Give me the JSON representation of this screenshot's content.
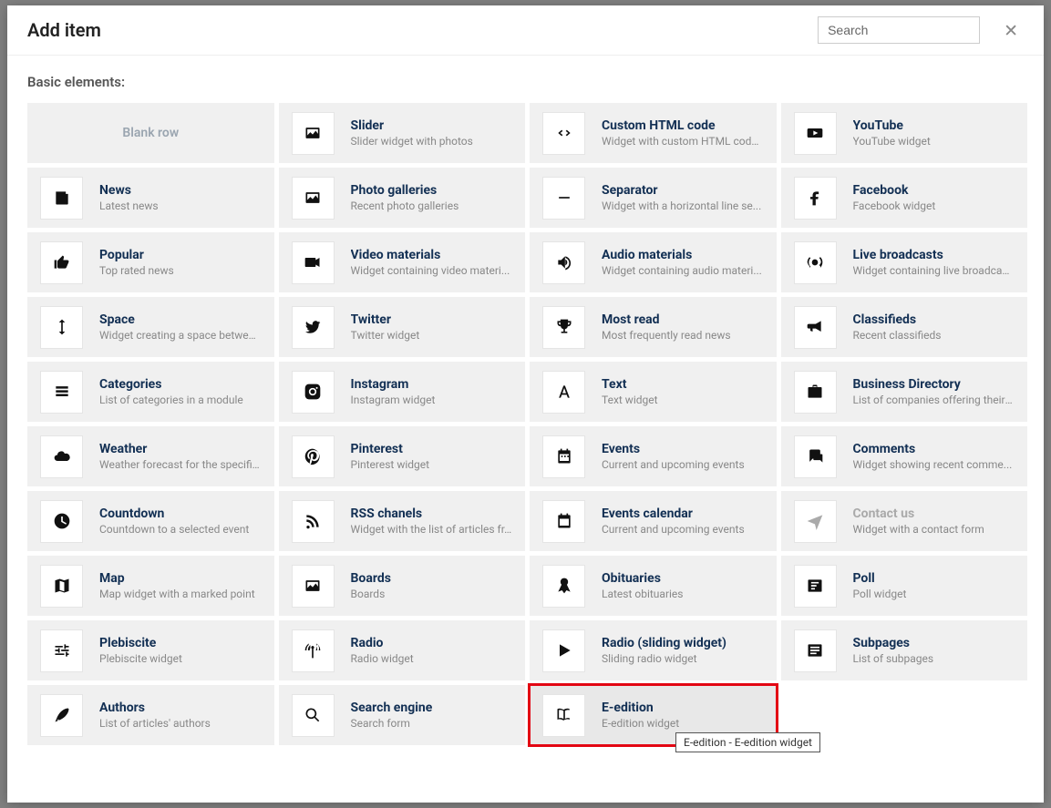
{
  "header": {
    "title": "Add item",
    "search_placeholder": "Search"
  },
  "section_title": "Basic elements:",
  "tooltip": "E-edition - E-edition widget",
  "items": [
    {
      "id": "blank-row",
      "icon": "",
      "title": "Blank row",
      "desc": "",
      "blank": true
    },
    {
      "id": "slider",
      "icon": "image",
      "title": "Slider",
      "desc": "Slider widget with photos"
    },
    {
      "id": "custom-html",
      "icon": "code",
      "title": "Custom HTML code",
      "desc": "Widget with custom HTML code..."
    },
    {
      "id": "youtube",
      "icon": "youtube",
      "title": "YouTube",
      "desc": "YouTube widget"
    },
    {
      "id": "news",
      "icon": "news",
      "title": "News",
      "desc": "Latest news"
    },
    {
      "id": "galleries",
      "icon": "image",
      "title": "Photo galleries",
      "desc": "Recent photo galleries"
    },
    {
      "id": "separator",
      "icon": "minus",
      "title": "Separator",
      "desc": "Widget with a horizontal line se..."
    },
    {
      "id": "facebook",
      "icon": "facebook",
      "title": "Facebook",
      "desc": "Facebook widget"
    },
    {
      "id": "popular",
      "icon": "thumb",
      "title": "Popular",
      "desc": "Top rated news"
    },
    {
      "id": "video",
      "icon": "video",
      "title": "Video materials",
      "desc": "Widget containing video materi..."
    },
    {
      "id": "audio",
      "icon": "audio",
      "title": "Audio materials",
      "desc": "Widget containing audio materi..."
    },
    {
      "id": "live",
      "icon": "live",
      "title": "Live broadcasts",
      "desc": "Widget containing live broadcasts"
    },
    {
      "id": "space",
      "icon": "arrows-v",
      "title": "Space",
      "desc": "Widget creating a space betwee..."
    },
    {
      "id": "twitter",
      "icon": "twitter",
      "title": "Twitter",
      "desc": "Twitter widget"
    },
    {
      "id": "most-read",
      "icon": "trophy",
      "title": "Most read",
      "desc": "Most frequently read news"
    },
    {
      "id": "classifieds",
      "icon": "bullhorn",
      "title": "Classifieds",
      "desc": "Recent classifieds"
    },
    {
      "id": "categories",
      "icon": "list",
      "title": "Categories",
      "desc": "List of categories in a module"
    },
    {
      "id": "instagram",
      "icon": "instagram",
      "title": "Instagram",
      "desc": "Instagram widget"
    },
    {
      "id": "text",
      "icon": "text",
      "title": "Text",
      "desc": "Text widget"
    },
    {
      "id": "business",
      "icon": "briefcase",
      "title": "Business Directory",
      "desc": "List of companies offering their ..."
    },
    {
      "id": "weather",
      "icon": "cloud",
      "title": "Weather",
      "desc": "Weather forecast for the specifie..."
    },
    {
      "id": "pinterest",
      "icon": "pinterest",
      "title": "Pinterest",
      "desc": "Pinterest widget"
    },
    {
      "id": "events",
      "icon": "calendar",
      "title": "Events",
      "desc": "Current and upcoming events"
    },
    {
      "id": "comments",
      "icon": "comments",
      "title": "Comments",
      "desc": "Widget showing recent comme..."
    },
    {
      "id": "countdown",
      "icon": "clock",
      "title": "Countdown",
      "desc": "Countdown to a selected event"
    },
    {
      "id": "rss",
      "icon": "rss",
      "title": "RSS chanels",
      "desc": "Widget with the list of articles fr..."
    },
    {
      "id": "events-cal",
      "icon": "cal2",
      "title": "Events calendar",
      "desc": "Current and upcoming events"
    },
    {
      "id": "contact",
      "icon": "plane",
      "title": "Contact us",
      "desc": "Widget with a contact form",
      "dim": true
    },
    {
      "id": "map",
      "icon": "map",
      "title": "Map",
      "desc": "Map widget with a marked point"
    },
    {
      "id": "boards",
      "icon": "image",
      "title": "Boards",
      "desc": "Boards"
    },
    {
      "id": "obituaries",
      "icon": "ribbon",
      "title": "Obituaries",
      "desc": "Latest obituaries"
    },
    {
      "id": "poll",
      "icon": "poll",
      "title": "Poll",
      "desc": "Poll widget"
    },
    {
      "id": "plebiscite",
      "icon": "sliders",
      "title": "Plebiscite",
      "desc": "Plebiscite widget"
    },
    {
      "id": "radio",
      "icon": "signal",
      "title": "Radio",
      "desc": "Radio widget"
    },
    {
      "id": "radio-slide",
      "icon": "play",
      "title": "Radio (sliding widget)",
      "desc": "Sliding radio widget"
    },
    {
      "id": "subpages",
      "icon": "listbox",
      "title": "Subpages",
      "desc": "List of subpages"
    },
    {
      "id": "authors",
      "icon": "feather",
      "title": "Authors",
      "desc": "List of articles' authors"
    },
    {
      "id": "search",
      "icon": "search",
      "title": "Search engine",
      "desc": "Search form"
    },
    {
      "id": "e-edition",
      "icon": "book",
      "title": "E-edition",
      "desc": "E-edition widget",
      "hl": true
    }
  ]
}
